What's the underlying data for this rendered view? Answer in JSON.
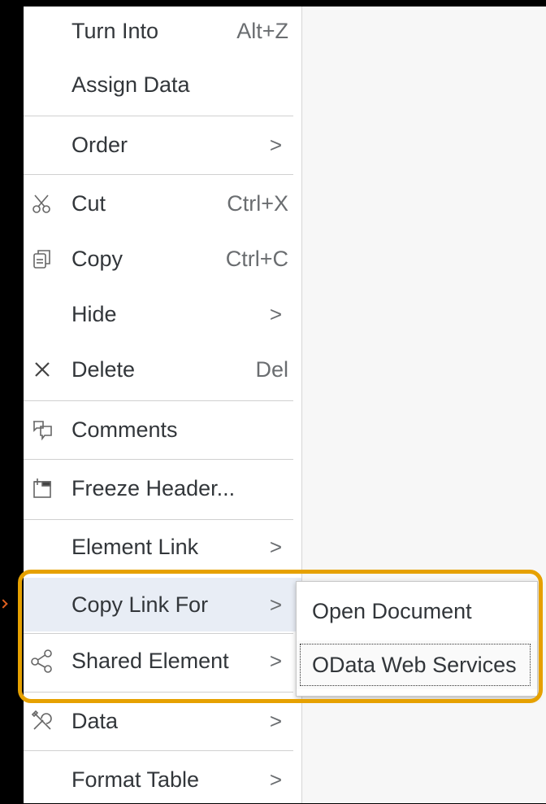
{
  "menu": {
    "items": [
      {
        "label": "Turn Into",
        "shortcut": "Alt+Z",
        "icon": ""
      },
      {
        "label": "Assign Data",
        "shortcut": "",
        "icon": ""
      },
      {
        "label": "Order",
        "submenu": true,
        "icon": ""
      },
      {
        "label": "Cut",
        "shortcut": "Ctrl+X",
        "icon": "scissors-icon"
      },
      {
        "label": "Copy",
        "shortcut": "Ctrl+C",
        "icon": "copy-icon"
      },
      {
        "label": "Hide",
        "submenu": true,
        "icon": ""
      },
      {
        "label": "Delete",
        "shortcut": "Del",
        "icon": "close-icon"
      },
      {
        "label": "Comments",
        "icon": "comments-icon"
      },
      {
        "label": "Freeze Header...",
        "icon": "freeze-header-icon"
      },
      {
        "label": "Element Link",
        "submenu": true,
        "icon": ""
      },
      {
        "label": "Copy Link For",
        "submenu": true,
        "icon": "",
        "state": "hovered"
      },
      {
        "label": "Shared Element",
        "submenu": true,
        "icon": "share-icon"
      },
      {
        "label": "Data",
        "submenu": true,
        "icon": "tools-icon"
      },
      {
        "label": "Format Table",
        "submenu": true,
        "icon": ""
      }
    ],
    "chevron": ">"
  },
  "submenu": {
    "items": [
      {
        "label": "Open Document"
      },
      {
        "label": "OData Web Services",
        "state": "focused"
      }
    ]
  },
  "colors": {
    "highlight": "#e6a100",
    "hover": "#e8edf5",
    "text": "#32363a"
  }
}
